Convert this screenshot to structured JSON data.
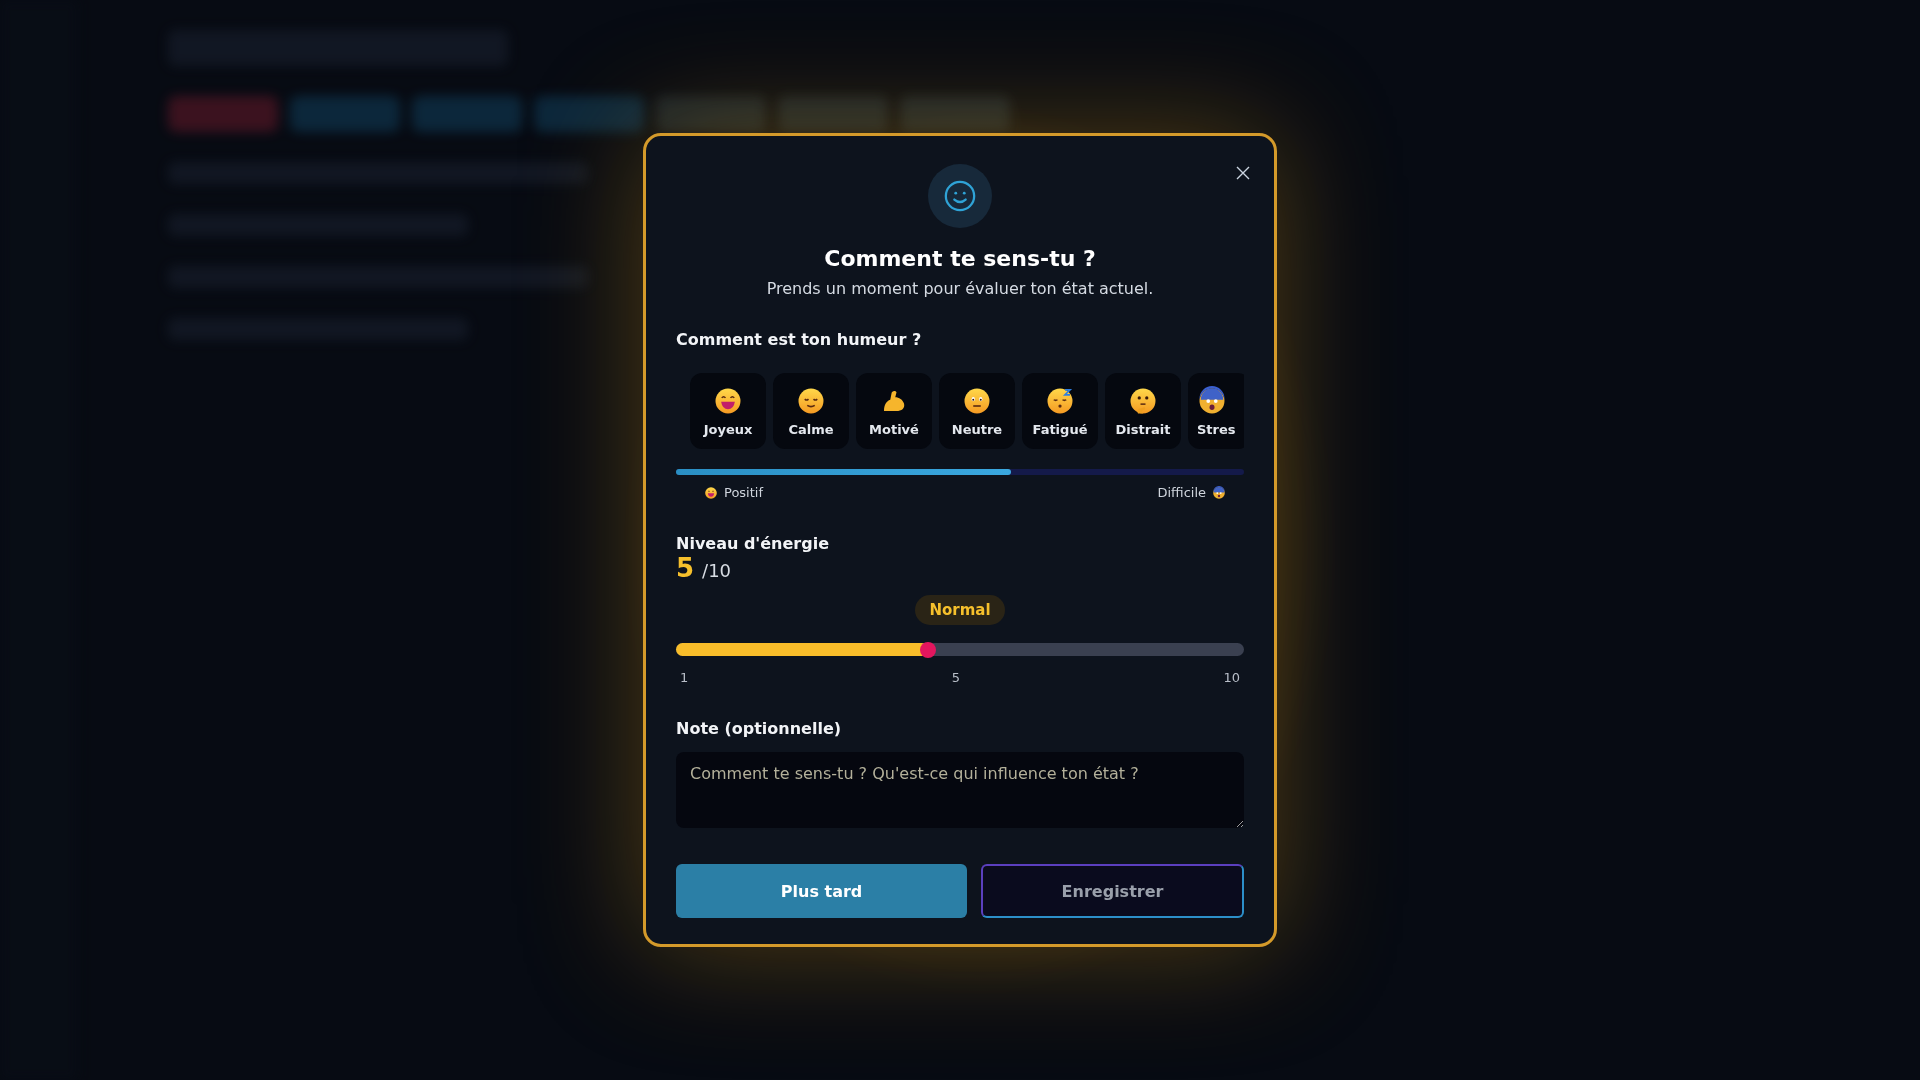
{
  "dialog": {
    "title": "Comment te sens-tu ?",
    "subtitle": "Prends un moment pour évaluer ton état actuel.",
    "mood": {
      "label": "Comment est ton humeur ?",
      "options": [
        {
          "label": "Joyeux",
          "kind": "grin",
          "selected": false
        },
        {
          "label": "Calme",
          "kind": "relieved",
          "selected": false
        },
        {
          "label": "Motivé",
          "kind": "bicep",
          "selected": false
        },
        {
          "label": "Neutre",
          "kind": "neutral",
          "selected": false
        },
        {
          "label": "Fatigué",
          "kind": "sleepy",
          "selected": false
        },
        {
          "label": "Distrait",
          "kind": "thinking",
          "selected": false
        },
        {
          "label": "Stres",
          "kind": "fearful",
          "selected": false
        }
      ],
      "scale_start": "Positif",
      "scale_end": "Difficile"
    },
    "energy": {
      "label": "Niveau d'énergie",
      "value": "5",
      "max": "/10",
      "status": "Normal",
      "level": 0.444,
      "ticks": [
        "1",
        "5",
        "10"
      ]
    },
    "note": {
      "label": "Note (optionnelle)",
      "placeholder": "Comment te sens-tu ? Qu'est-ce qui influence ton état ?"
    },
    "buttons": [
      {
        "label": "Plus tard",
        "kind": "primary"
      },
      {
        "label": "Enregistrer",
        "kind": "outline"
      }
    ]
  }
}
